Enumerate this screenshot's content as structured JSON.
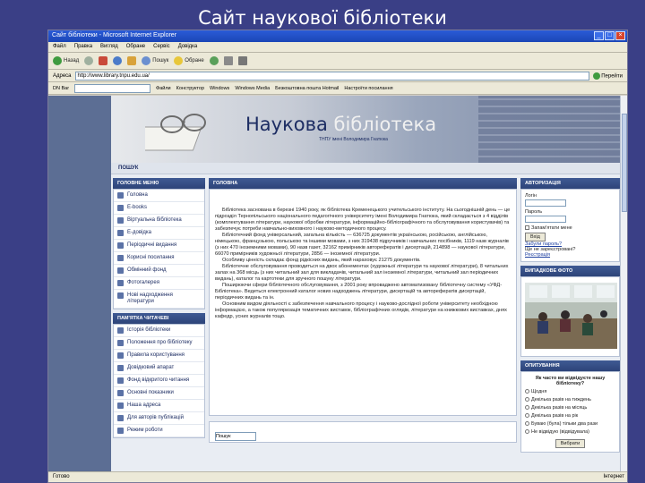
{
  "slide_title": "Сайт наукової бібліотеки",
  "window": {
    "title": "Сайт бібліотеки - Microsoft Internet Explorer",
    "menu": [
      "Файл",
      "Правка",
      "Вигляд",
      "Обране",
      "Сервіс",
      "Довідка"
    ],
    "toolbar": {
      "back": "Назад",
      "search": "Пошук",
      "favorites": "Обране"
    },
    "address_label": "Адреса",
    "address_value": "http://www.library.tnpu.edu.ua/",
    "go_label": "Перейти",
    "links_label": "DN Bar",
    "links_bar": [
      "Файли",
      "Конструктор",
      "Windows",
      "Windows Media",
      "Безкоштовна пошта Hotmail",
      "Настроїти посилання"
    ],
    "status_left": "Готово",
    "status_right": "Інтернет"
  },
  "site": {
    "title_part1": "Наукова ",
    "title_part2": "бібліотека",
    "subtitle": "ТНПУ імені Володимира Гнатюка",
    "search_label": "ПОШУК"
  },
  "main_menu": {
    "header": "ГОЛОВНЕ МЕНЮ",
    "items": [
      "Головна",
      "E-books",
      "Віртуальна бібліотека",
      "E-довідка",
      "Періодичні видання",
      "Корисні посилання",
      "Обмінний фонд",
      "Фотогалерея",
      "Нові надходження літератури"
    ]
  },
  "reader_menu": {
    "header": "ПАМ'ЯТКА ЧИТАЧЕВІ",
    "items": [
      "Історія бібліотеки",
      "Положення про бібліотеку",
      "Правила користування",
      "Довідковий апарат",
      "Фонд відкритого читання",
      "Основні показники",
      "Наша адреса",
      "Для авторів публікацій",
      "Режим роботи"
    ]
  },
  "center": {
    "header": "ГОЛОВНА",
    "paragraphs": [
      "Бібліотека заснована в березні 1940 року, як бібліотека Кременецького учительського інституту. На сьогоднішній день — це підрозділ Тернопільського національного педагогічного університету імені Володимира Гнатюка, який складається з 4 відділів (комплектування літератури, наукової обробки літератури, інформаційно-бібліографічного та обслуговування користувачів) та забезпечує потреби навчально-виховного і науково-методичного процесу.",
      "Бібліотечний фонд універсальний, загальна кількість — 636725 документів українською, російською, англійською, німецькою, французькою, польською та іншими мовами, з них 319438 підручників і навчальних посібників, 1119 назв журналів (з них 470 іноземними мовами), 90 назв газет, 32162 примірників авторефератів і дисертацій, 214898 — наукової літератури, 66070 примірників художньої літератури, 2856 — іноземної літератури.",
      "Особливу цінність складає фонд рідкісних видань, який нараховує 21275 документів.",
      "Бібліотечне обслуговування проводиться на двох абонементах (художньої літератури та наукової літератури), 8 читальних залах на 368 місць (з них читальний зал для викладачів, читальний зал іноземної літератури, читальний зал періодичних видань), каталог та картотеки для зручного пошуку літератури.",
      "Поширюючи сфери бібліотечного обслуговування, з 2001 року впроваджено автоматизовану бібліотечну систему «УФД-Бібліотека». Ведеться електронний каталог нових надходжень літератури, дисертацій та авторефератів дисертацій, періодичних видань та ін.",
      "Основним видом діяльності є забезпечення навчального процесу і науково-дослідної роботи університету необхідною інформацією, а також популяризація тематичних виставок, бібліографічних оглядів, літератури на книжкових виставках, днях кафедр, усних журналів тощо."
    ],
    "search_button": "Пошук"
  },
  "auth": {
    "header": "АВТОРИЗАЦІЯ",
    "login_label": "Логін",
    "password_label": "Пароль",
    "remember_label": "Запам'ятати мене",
    "login_button": "Вхід",
    "forgot_link": "Забули пароль?",
    "register_text": "Ще не зареєстровані?",
    "register_link": "Реєстрація"
  },
  "photo_block": {
    "header": "ВИПАДКОВЕ ФОТО"
  },
  "poll": {
    "header": "ОПИТУВАННЯ",
    "question": "Як часто ви відвідуєте нашу бібліотеку?",
    "options": [
      "Щодня",
      "Декілька разів на тиждень",
      "Декілька разів на місяць",
      "Декілька разів на рік",
      "Буваю (була) тільки два рази",
      "Не відвідую (відвідувала)"
    ],
    "vote_button": "Вибрати"
  }
}
